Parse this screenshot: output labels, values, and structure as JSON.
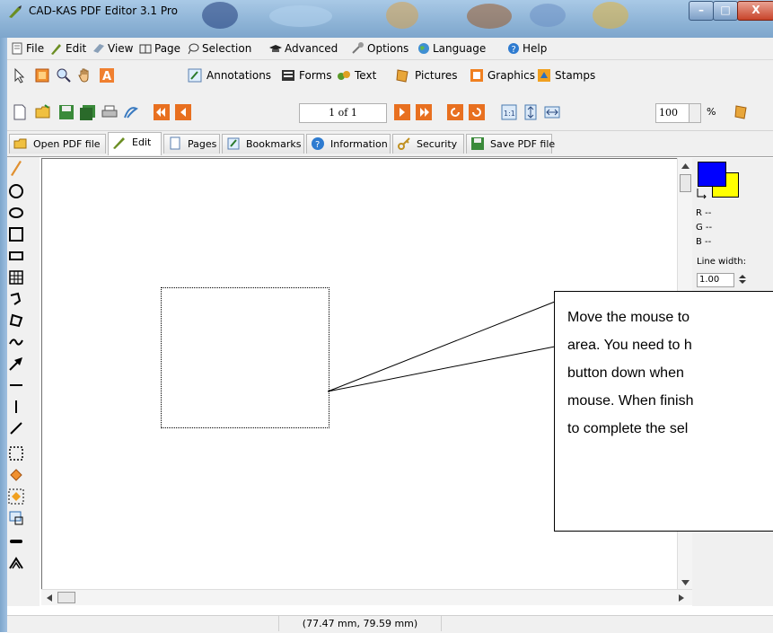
{
  "window": {
    "title": "CAD-KAS PDF Editor 3.1 Pro",
    "controls": {
      "minimize": "–",
      "maximize": "□",
      "close": "X"
    }
  },
  "menu": [
    "File",
    "Edit",
    "View",
    "Page",
    "Selection",
    "Advanced",
    "Options",
    "Language",
    "Help"
  ],
  "toolbar_modes": [
    "Annotations",
    "Forms",
    "Text",
    "Pictures",
    "Graphics",
    "Stamps"
  ],
  "navigation": {
    "page_indicator": "1 of 1",
    "zoom_value": "100",
    "zoom_unit": "%"
  },
  "tabs": [
    {
      "label": "Open PDF file",
      "active": false
    },
    {
      "label": "Edit",
      "active": true
    },
    {
      "label": "Pages",
      "active": false
    },
    {
      "label": "Bookmarks",
      "active": false
    },
    {
      "label": "Information",
      "active": false
    },
    {
      "label": "Security",
      "active": false
    },
    {
      "label": "Save PDF file",
      "active": false
    }
  ],
  "color_panel": {
    "foreground": "#0000ff",
    "background": "#ffff00",
    "r_label": "R --",
    "g_label": "G --",
    "b_label": "B --",
    "line_width_label": "Line width:",
    "line_width_value": "1.00"
  },
  "callout": {
    "lines": [
      "Move the mouse to",
      "area. You need to h",
      "button down when",
      "mouse. When finish",
      "to complete the sel"
    ]
  },
  "status": {
    "coordinates": "(77.47 mm, 79.59 mm)"
  }
}
